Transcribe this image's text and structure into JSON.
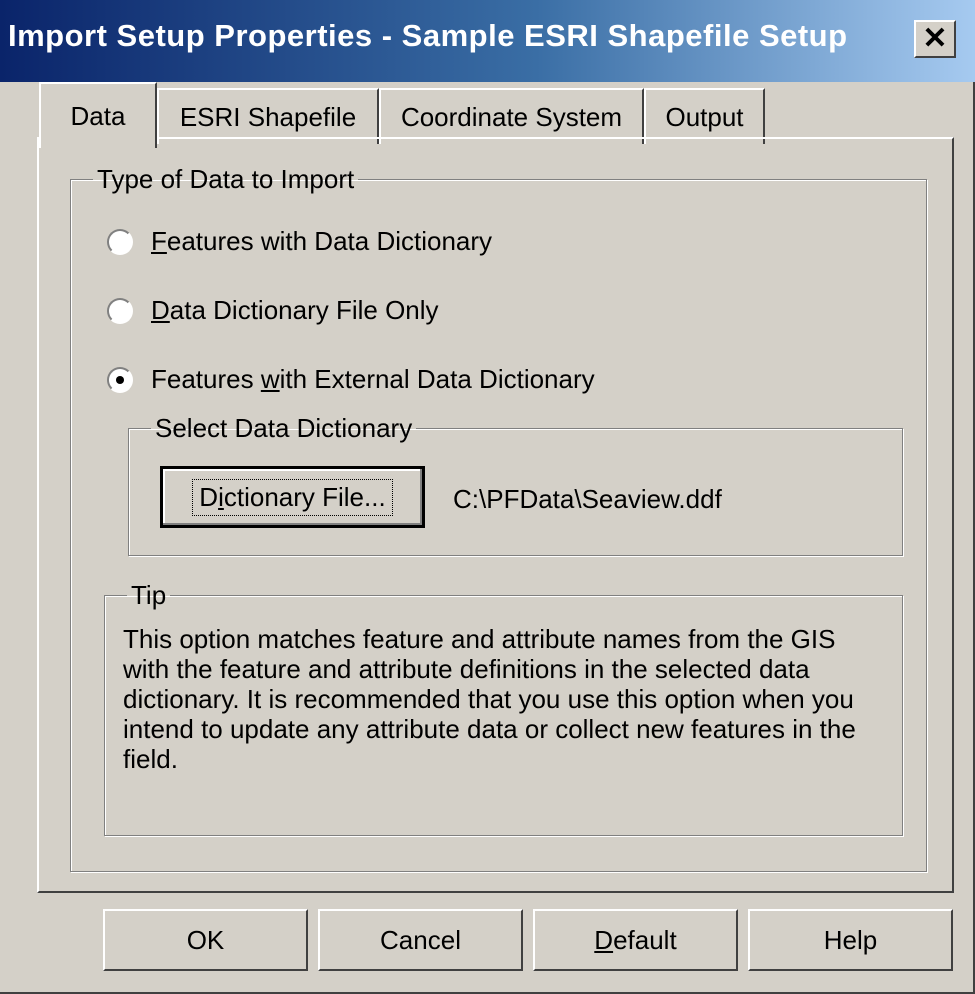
{
  "window": {
    "title": "Import Setup Properties - Sample ESRI Shapefile Setup",
    "close_symbol": "✕"
  },
  "tabs": [
    {
      "label": "Data",
      "active": true
    },
    {
      "label": "ESRI Shapefile",
      "active": false
    },
    {
      "label": "Coordinate System",
      "active": false
    },
    {
      "label": "Output",
      "active": false
    }
  ],
  "data_tab": {
    "type_group": {
      "legend": "Type of Data to Import",
      "options": [
        {
          "pre": "",
          "hotkey": "F",
          "post": "eatures with Data Dictionary",
          "selected": false
        },
        {
          "pre": "",
          "hotkey": "D",
          "post": "ata Dictionary File Only",
          "selected": false
        },
        {
          "pre": "Features ",
          "hotkey": "w",
          "post": "ith External Data Dictionary",
          "selected": true
        }
      ]
    },
    "dictionary_group": {
      "legend": "Select Data Dictionary",
      "button": {
        "pre": "D",
        "hotkey": "i",
        "post": "ctionary File..."
      },
      "file_path": "C:\\PFData\\Seaview.ddf"
    },
    "tip_group": {
      "legend": "Tip",
      "text": "This option matches feature and attribute names from the GIS with the feature and attribute definitions in the selected data dictionary.  It is recommended that you use this option when you intend to update any attribute data or collect new features in the field."
    }
  },
  "buttons": {
    "ok": "OK",
    "cancel": "Cancel",
    "default_hotkey": "D",
    "default_rest": "efault",
    "help": "Help"
  }
}
